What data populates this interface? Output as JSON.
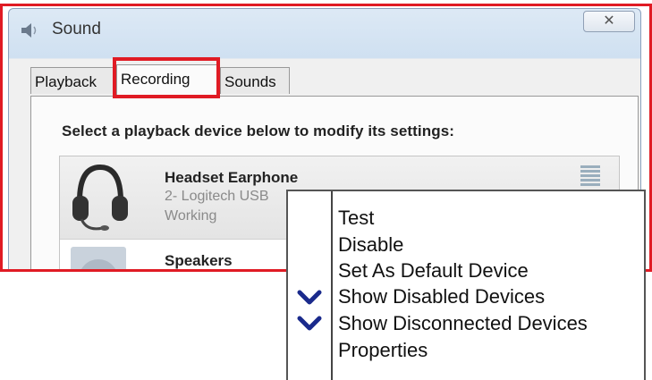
{
  "window": {
    "title": "Sound",
    "close_label": "✕"
  },
  "tabs": [
    {
      "label": "Playback"
    },
    {
      "label": "Recording"
    },
    {
      "label": "Sounds"
    }
  ],
  "panel": {
    "instruction": "Select a playback device below to modify its settings:"
  },
  "devices": [
    {
      "name": "Headset Earphone",
      "sub": "2- Logitech USB",
      "status": "Working",
      "icon": "headset-icon"
    },
    {
      "name": "Speakers",
      "icon": "speaker-icon"
    }
  ],
  "context_menu": {
    "items": [
      {
        "label": "Test"
      },
      {
        "label": "Disable"
      },
      {
        "label": "Set As Default Device"
      },
      {
        "label": "Show Disabled Devices",
        "checked": true
      },
      {
        "label": "Show Disconnected Devices",
        "checked": true
      },
      {
        "label": "Properties"
      }
    ]
  },
  "colors": {
    "highlight": "#e01b24",
    "check": "#1a2a8c"
  }
}
